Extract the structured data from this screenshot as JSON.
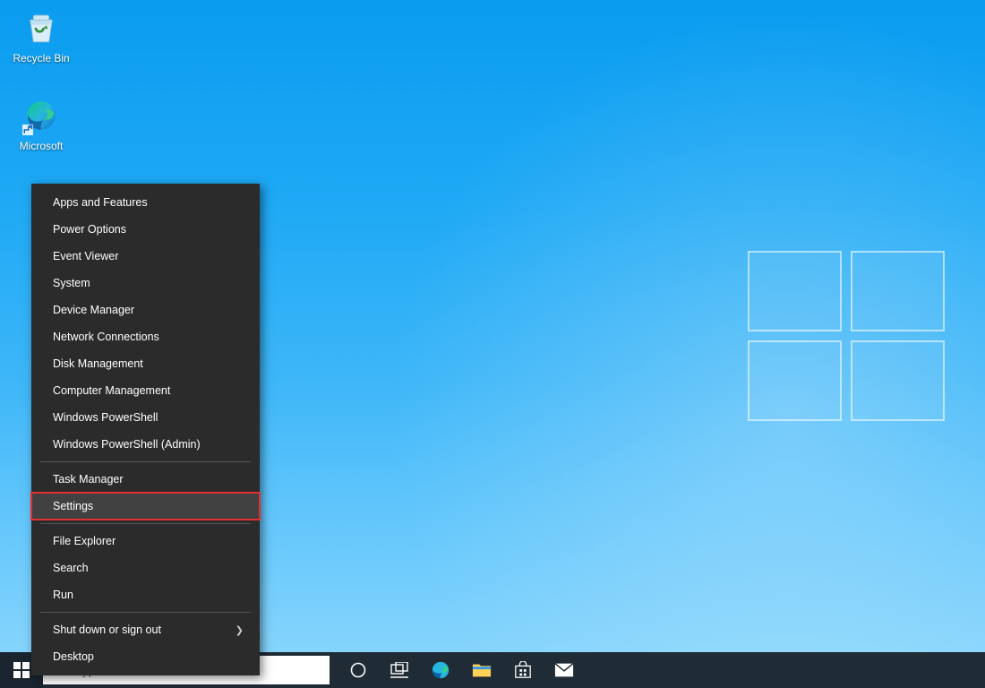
{
  "desktop": {
    "icons": [
      {
        "label": "Recycle Bin"
      },
      {
        "label": "Microsoft"
      }
    ]
  },
  "winx_menu": {
    "groups": [
      [
        "Apps and Features",
        "Power Options",
        "Event Viewer",
        "System",
        "Device Manager",
        "Network Connections",
        "Disk Management",
        "Computer Management",
        "Windows PowerShell",
        "Windows PowerShell (Admin)"
      ],
      [
        "Task Manager",
        "Settings"
      ],
      [
        "File Explorer",
        "Search",
        "Run"
      ],
      [
        "Shut down or sign out",
        "Desktop"
      ]
    ],
    "highlighted": "Settings",
    "has_submenu": "Shut down or sign out"
  },
  "taskbar": {
    "search_placeholder": "Type here to search"
  }
}
